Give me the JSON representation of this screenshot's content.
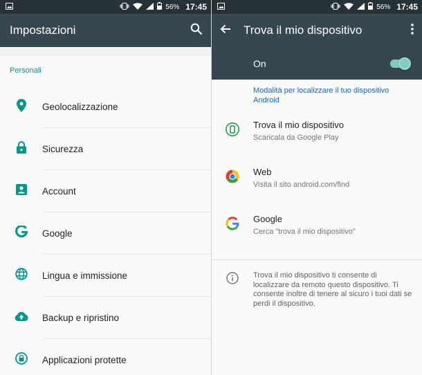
{
  "status_bar": {
    "left_panel": {
      "battery": "56%",
      "time": "17:45"
    },
    "right_panel": {
      "battery": "56%",
      "time": "17:45"
    }
  },
  "settings_screen": {
    "title": "Impostazioni",
    "section_label": "Personali",
    "items": [
      {
        "label": "Geolocalizzazione",
        "icon": "location-pin-icon"
      },
      {
        "label": "Sicurezza",
        "icon": "lock-icon"
      },
      {
        "label": "Account",
        "icon": "account-box-icon"
      },
      {
        "label": "Google",
        "icon": "google-g-icon"
      },
      {
        "label": "Lingua e immissione",
        "icon": "globe-icon"
      },
      {
        "label": "Backup e ripristino",
        "icon": "cloud-upload-icon"
      },
      {
        "label": "Applicazioni protette",
        "icon": "protected-apps-lock-icon"
      }
    ]
  },
  "find_device_screen": {
    "title": "Trova il mio dispositivo",
    "toggle_label": "On",
    "toggle_state": true,
    "mode_link": "Modalità per localizzare il tuo dispositivo Android",
    "methods": [
      {
        "title": "Trova il mio dispositivo",
        "subtitle": "Scaricala da Google Play",
        "icon": "find-my-device-app-icon"
      },
      {
        "title": "Web",
        "subtitle": "Visita il sito android.com/find",
        "icon": "chrome-icon"
      },
      {
        "title": "Google",
        "subtitle": "Cerca \"trova il mio dispositivo\"",
        "icon": "google-g-color-icon"
      }
    ],
    "info_text": "Trova il mio dispositivo ti consente di localizzare da remoto questo dispositivo. Ti consente inoltre di tenere al sicuro i tuoi dati se perdi il dispositivo."
  },
  "colors": {
    "app_bar": "#37474f",
    "status_bar": "#263238",
    "accent": "#009688",
    "link": "#1565c0",
    "toggle": "#80cbc4"
  }
}
